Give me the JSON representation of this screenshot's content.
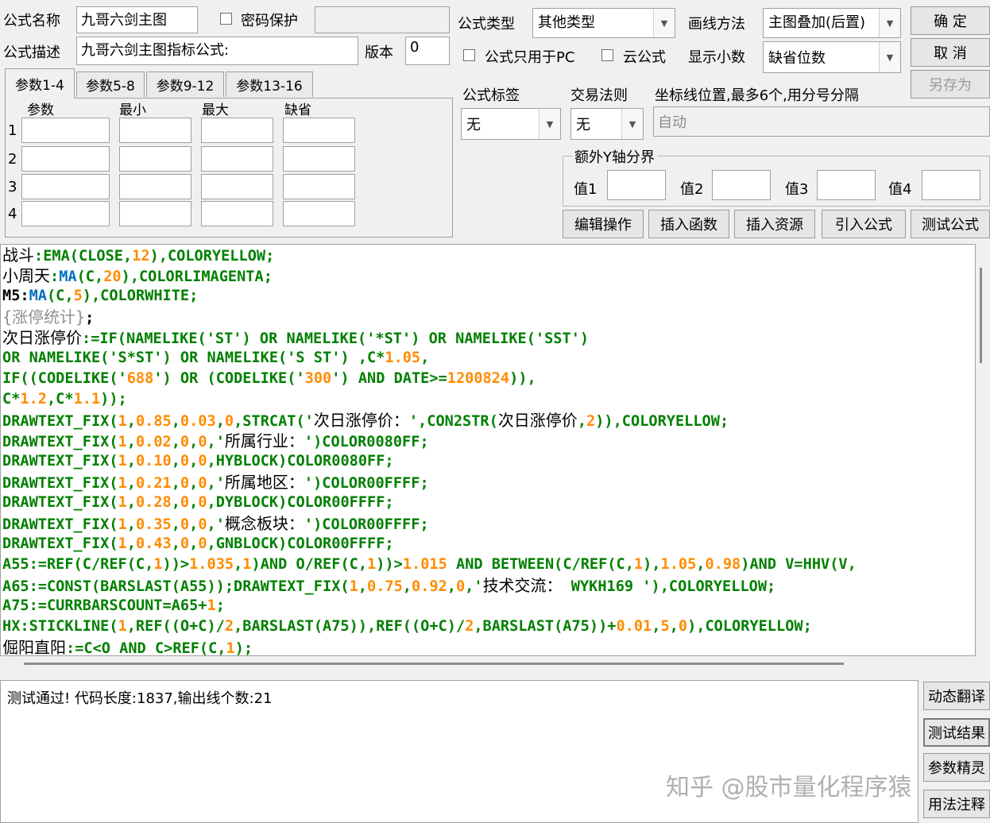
{
  "header": {
    "name_label": "公式名称",
    "name_value": "九哥六剑主图",
    "password_label": "密码保护",
    "desc_label": "公式描述",
    "desc_value": "九哥六剑主图指标公式:",
    "version_label": "版本",
    "version_value": "0",
    "type_label": "公式类型",
    "type_value": "其他类型",
    "draw_label": "画线方法",
    "draw_value": "主图叠加(后置)",
    "pc_only_label": "公式只用于PC",
    "cloud_label": "云公式",
    "decimal_label": "显示小数",
    "decimal_value": "缺省位数",
    "ok_label": "确  定",
    "cancel_label": "取  消",
    "saveas_label": "另存为"
  },
  "params": {
    "tabs": [
      "参数1-4",
      "参数5-8",
      "参数9-12",
      "参数13-16"
    ],
    "columns": [
      "参数",
      "最小",
      "最大",
      "缺省"
    ],
    "rows": [
      "1",
      "2",
      "3",
      "4"
    ]
  },
  "options": {
    "tag_label": "公式标签",
    "tag_value": "无",
    "rule_label": "交易法则",
    "rule_value": "无",
    "axis_label": "坐标线位置,最多6个,用分号分隔",
    "axis_placeholder": "自动",
    "yaxis_group": "额外Y轴分界",
    "y_values": [
      "值1",
      "值2",
      "值3",
      "值4"
    ]
  },
  "toolbar": {
    "edit": "编辑操作",
    "insert_func": "插入函数",
    "insert_res": "插入资源",
    "import": "引入公式",
    "test": "测试公式"
  },
  "code_lines": [
    [
      [
        "战斗",
        "d"
      ],
      [
        ":",
        "k"
      ],
      [
        "EMA",
        "k"
      ],
      [
        "(CLOSE,",
        "k"
      ],
      [
        "12",
        "n"
      ],
      [
        "),COLORYELLOW;",
        "k"
      ]
    ],
    [
      [
        "小周天",
        "d"
      ],
      [
        ":",
        "k"
      ],
      [
        "MA",
        "f"
      ],
      [
        "(C,",
        "k"
      ],
      [
        "20",
        "n"
      ],
      [
        "),COLORLIMAGENTA;",
        "k"
      ]
    ],
    [
      [
        "M5:",
        "s"
      ],
      [
        "MA",
        "f"
      ],
      [
        "(C,",
        "k"
      ],
      [
        "5",
        "n"
      ],
      [
        "),COLORWHITE;",
        "k"
      ]
    ],
    [
      [
        "{涨停统计}",
        "c"
      ],
      [
        ";",
        "s"
      ]
    ],
    [
      [
        "次日涨停价",
        "d"
      ],
      [
        ":=IF(NAMELIKE('ST') OR NAMELIKE('*ST') OR NAMELIKE('SST')",
        "k"
      ]
    ],
    [
      [
        "OR NAMELIKE('S*ST') OR NAMELIKE('S ST') ,C*",
        "k"
      ],
      [
        "1.05",
        "n"
      ],
      [
        ",",
        "k"
      ]
    ],
    [
      [
        "IF((CODELIKE('",
        "k"
      ],
      [
        "688",
        "n"
      ],
      [
        "') OR (CODELIKE('",
        "k"
      ],
      [
        "300",
        "n"
      ],
      [
        "') AND DATE>=",
        "k"
      ],
      [
        "1200824",
        "n"
      ],
      [
        ")),",
        "k"
      ]
    ],
    [
      [
        "C*",
        "k"
      ],
      [
        "1.2",
        "n"
      ],
      [
        ",C*",
        "k"
      ],
      [
        "1.1",
        "n"
      ],
      [
        "));",
        "k"
      ]
    ],
    [
      [
        "DRAWTEXT_FIX(",
        "k"
      ],
      [
        "1",
        "n"
      ],
      [
        ",",
        "k"
      ],
      [
        "0.85",
        "n"
      ],
      [
        ",",
        "k"
      ],
      [
        "0.03",
        "n"
      ],
      [
        ",",
        "k"
      ],
      [
        "0",
        "n"
      ],
      [
        ",STRCAT('",
        "k"
      ],
      [
        "次日涨停价：",
        "d"
      ],
      [
        "',CON2STR(",
        "k"
      ],
      [
        "次日涨停价",
        "d"
      ],
      [
        ",",
        "k"
      ],
      [
        "2",
        "n"
      ],
      [
        ")),COLORYELLOW;",
        "k"
      ]
    ],
    [
      [
        "DRAWTEXT_FIX(",
        "k"
      ],
      [
        "1",
        "n"
      ],
      [
        ",",
        "k"
      ],
      [
        "0.02",
        "n"
      ],
      [
        ",",
        "k"
      ],
      [
        "0",
        "n"
      ],
      [
        ",",
        "k"
      ],
      [
        "0",
        "n"
      ],
      [
        ",'",
        "k"
      ],
      [
        "所属行业：",
        "d"
      ],
      [
        "')COLOR0080FF;",
        "k"
      ]
    ],
    [
      [
        "DRAWTEXT_FIX(",
        "k"
      ],
      [
        "1",
        "n"
      ],
      [
        ",",
        "k"
      ],
      [
        "0.10",
        "n"
      ],
      [
        ",",
        "k"
      ],
      [
        "0",
        "n"
      ],
      [
        ",",
        "k"
      ],
      [
        "0",
        "n"
      ],
      [
        ",HYBLOCK)COLOR0080FF;",
        "k"
      ]
    ],
    [
      [
        "DRAWTEXT_FIX(",
        "k"
      ],
      [
        "1",
        "n"
      ],
      [
        ",",
        "k"
      ],
      [
        "0.21",
        "n"
      ],
      [
        ",",
        "k"
      ],
      [
        "0",
        "n"
      ],
      [
        ",",
        "k"
      ],
      [
        "0",
        "n"
      ],
      [
        ",'",
        "k"
      ],
      [
        "所属地区：",
        "d"
      ],
      [
        "')COLOR00FFFF;",
        "k"
      ]
    ],
    [
      [
        "DRAWTEXT_FIX(",
        "k"
      ],
      [
        "1",
        "n"
      ],
      [
        ",",
        "k"
      ],
      [
        "0.28",
        "n"
      ],
      [
        ",",
        "k"
      ],
      [
        "0",
        "n"
      ],
      [
        ",",
        "k"
      ],
      [
        "0",
        "n"
      ],
      [
        ",DYBLOCK)COLOR00FFFF;",
        "k"
      ]
    ],
    [
      [
        "DRAWTEXT_FIX(",
        "k"
      ],
      [
        "1",
        "n"
      ],
      [
        ",",
        "k"
      ],
      [
        "0.35",
        "n"
      ],
      [
        ",",
        "k"
      ],
      [
        "0",
        "n"
      ],
      [
        ",",
        "k"
      ],
      [
        "0",
        "n"
      ],
      [
        ",'",
        "k"
      ],
      [
        "概念板块：",
        "d"
      ],
      [
        "')COLOR00FFFF;",
        "k"
      ]
    ],
    [
      [
        "DRAWTEXT_FIX(",
        "k"
      ],
      [
        "1",
        "n"
      ],
      [
        ",",
        "k"
      ],
      [
        "0.43",
        "n"
      ],
      [
        ",",
        "k"
      ],
      [
        "0",
        "n"
      ],
      [
        ",",
        "k"
      ],
      [
        "0",
        "n"
      ],
      [
        ",GNBLOCK)COLOR00FFFF;",
        "k"
      ]
    ],
    [
      [
        "A55:=REF(C/REF(C,",
        "k"
      ],
      [
        "1",
        "n"
      ],
      [
        "))>",
        "k"
      ],
      [
        "1.035",
        "n"
      ],
      [
        ",",
        "k"
      ],
      [
        "1",
        "n"
      ],
      [
        ")AND O/REF(C,",
        "k"
      ],
      [
        "1",
        "n"
      ],
      [
        "))>",
        "k"
      ],
      [
        "1.015",
        "n"
      ],
      [
        " AND BETWEEN(C/REF(C,",
        "k"
      ],
      [
        "1",
        "n"
      ],
      [
        "),",
        "k"
      ],
      [
        "1.05",
        "n"
      ],
      [
        ",",
        "k"
      ],
      [
        "0.98",
        "n"
      ],
      [
        ")AND V=HHV(V,",
        "k"
      ]
    ],
    [
      [
        "A65:=CONST(BARSLAST(A55));DRAWTEXT_FIX(",
        "k"
      ],
      [
        "1",
        "n"
      ],
      [
        ",",
        "k"
      ],
      [
        "0.75",
        "n"
      ],
      [
        ",",
        "k"
      ],
      [
        "0.92",
        "n"
      ],
      [
        ",",
        "k"
      ],
      [
        "0",
        "n"
      ],
      [
        ",'",
        "k"
      ],
      [
        "技术交流：",
        "d"
      ],
      [
        " WYKH169 '),COLORYELLOW;",
        "k"
      ]
    ],
    [
      [
        "A75:=CURRBARSCOUNT=A65+",
        "k"
      ],
      [
        "1",
        "n"
      ],
      [
        ";",
        "k"
      ]
    ],
    [
      [
        "HX:STICKLINE(",
        "k"
      ],
      [
        "1",
        "n"
      ],
      [
        ",REF((O+C)/",
        "k"
      ],
      [
        "2",
        "n"
      ],
      [
        ",BARSLAST(A75)),REF((O+C)/",
        "k"
      ],
      [
        "2",
        "n"
      ],
      [
        ",BARSLAST(A75))+",
        "k"
      ],
      [
        "0.01",
        "n"
      ],
      [
        ",",
        "k"
      ],
      [
        "5",
        "n"
      ],
      [
        ",",
        "k"
      ],
      [
        "0",
        "n"
      ],
      [
        "),COLORYELLOW;",
        "k"
      ]
    ],
    [
      [
        "倔阳直阳",
        "d"
      ],
      [
        ":=C<O AND C>REF(C,",
        "k"
      ],
      [
        "1",
        "n"
      ],
      [
        ");",
        "k"
      ]
    ]
  ],
  "result": {
    "text": "测试通过! 代码长度:1837,输出线个数:21"
  },
  "side_buttons": [
    "动态翻译",
    "测试结果",
    "参数精灵",
    "用法注释"
  ],
  "watermark": "知乎 @股市量化程序猿",
  "colors": {
    "keyword": "#008000",
    "function": "#0070c0",
    "number": "#ff8c00",
    "comment": "#909090"
  }
}
